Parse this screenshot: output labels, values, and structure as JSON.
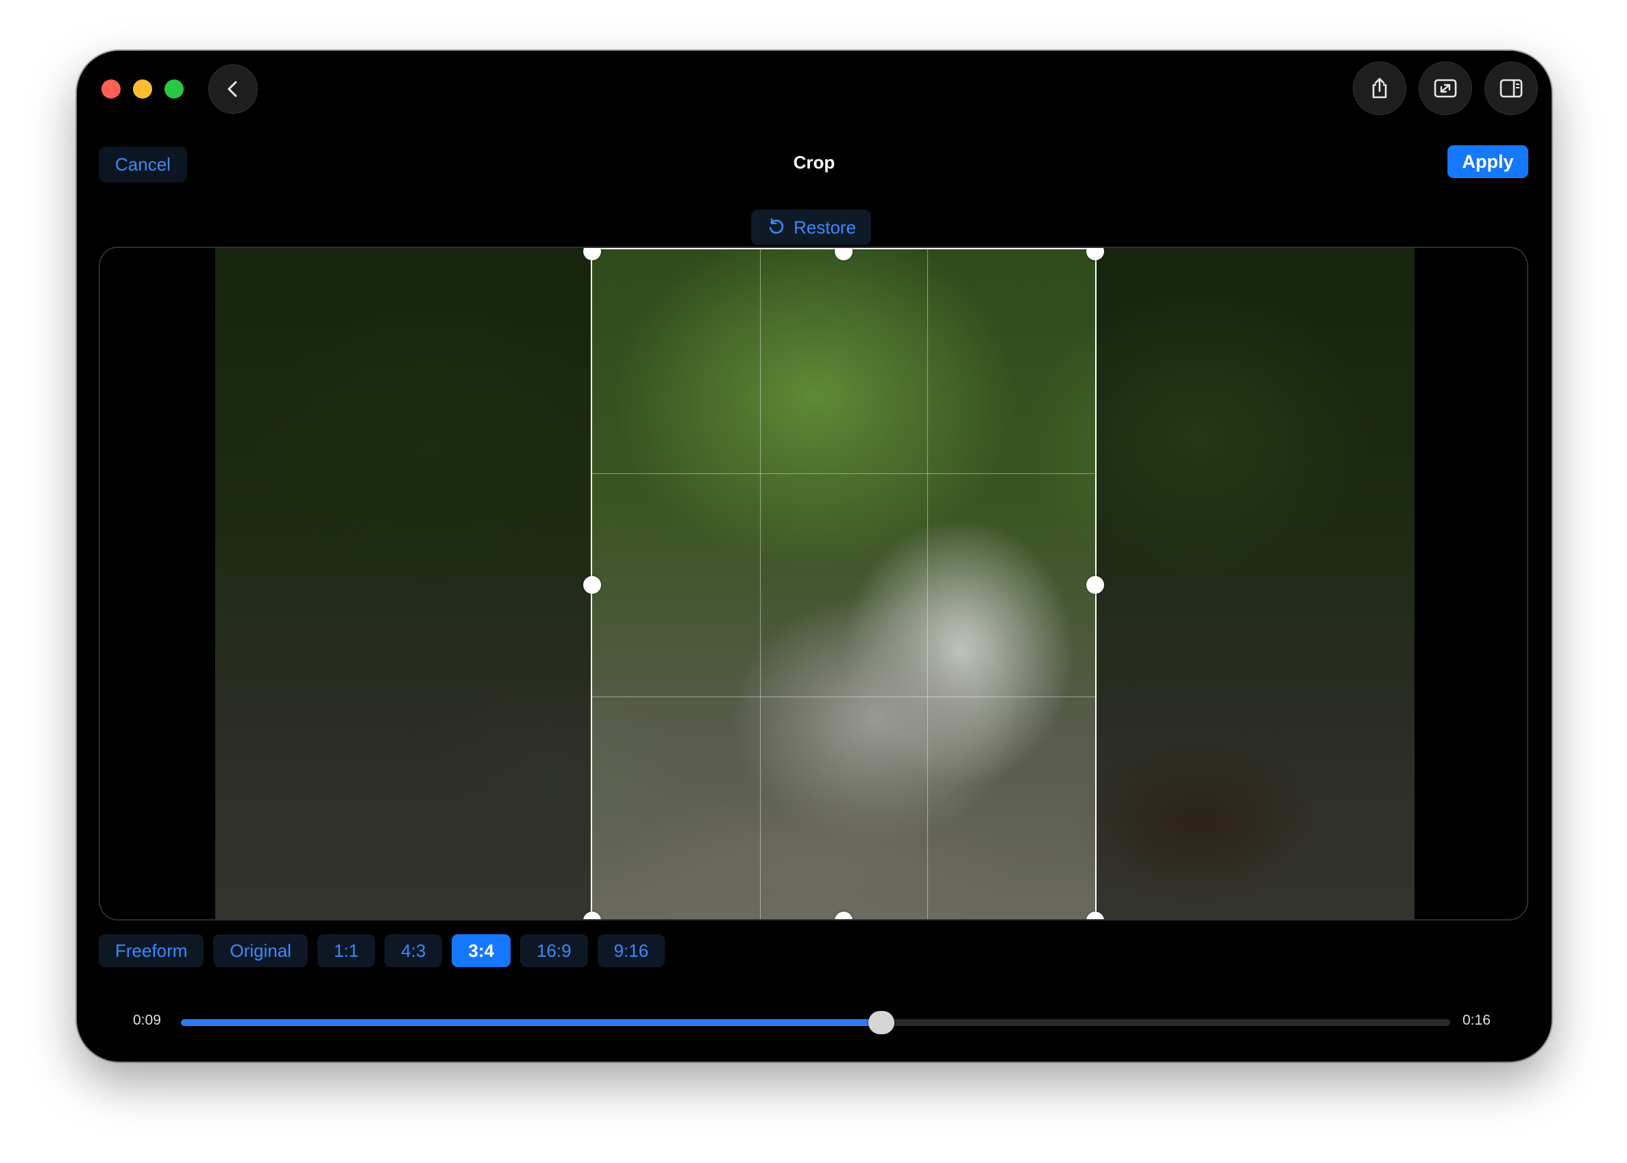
{
  "header": {
    "cancel_label": "Cancel",
    "title": "Crop",
    "apply_label": "Apply",
    "restore_label": "Restore"
  },
  "toolbar_icons": [
    "chevron-left-icon",
    "share-icon",
    "fit-screen-icon",
    "sidebar-icon"
  ],
  "aspect_ratios": {
    "options": [
      "Freeform",
      "Original",
      "1:1",
      "4:3",
      "3:4",
      "16:9",
      "9:16"
    ],
    "selected": "3:4"
  },
  "timeline": {
    "current_time": "0:09",
    "end_time": "0:16",
    "progress": 0.552
  },
  "colors": {
    "accent": "#1677ff",
    "link": "#3a8bff",
    "background": "#000000"
  }
}
